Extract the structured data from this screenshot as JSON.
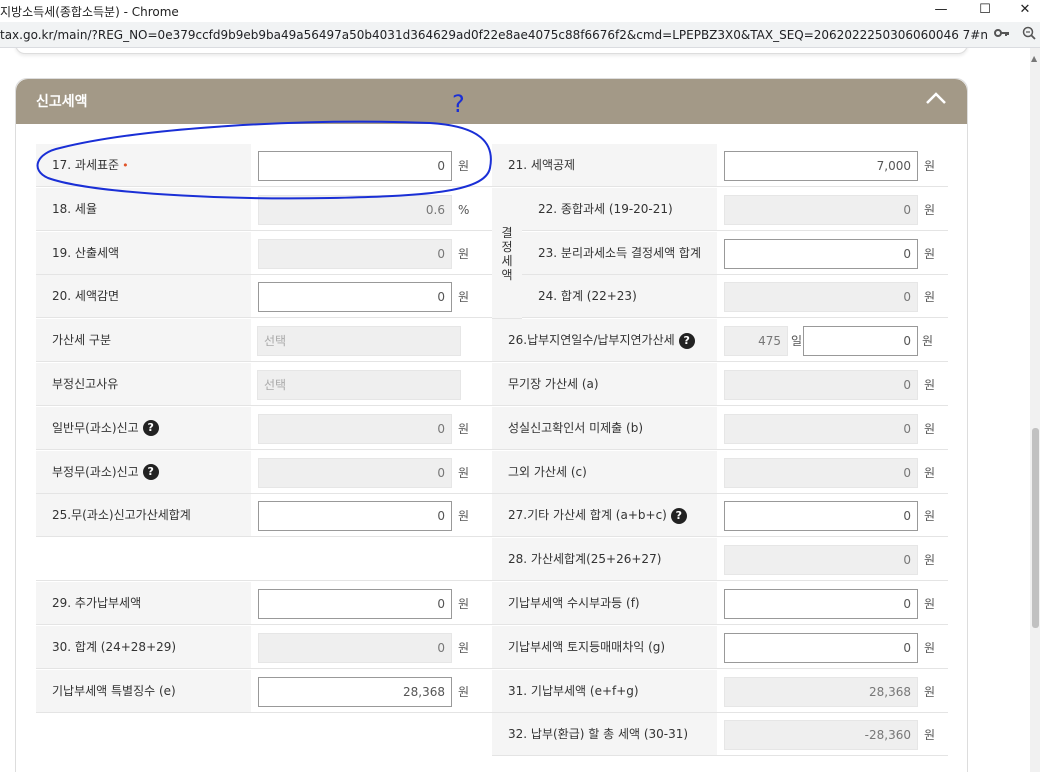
{
  "window": {
    "title": "지방소득세(종합소득분) - Chrome",
    "minimize": "—",
    "maximize": "☐",
    "close": "✕"
  },
  "address": {
    "url": "tax.go.kr/main/?REG_NO=0e379ccfd9b9eb9ba49a56497a50b4031d364629ad0f22e8ae4075c88f6676f2&cmd=LPEPBZ3X0&TAX_SEQ=2062022250306060046 7#n"
  },
  "section": {
    "title": "신고세액"
  },
  "annotation": {
    "mark": "?"
  },
  "units": {
    "won": "원",
    "percent": "%",
    "day": "일"
  },
  "left": [
    {
      "label": "17. 과세표준",
      "required": "•",
      "value": "0",
      "unit": "won",
      "editable": true
    },
    {
      "label": "18. 세율",
      "value": "0.6",
      "unit": "percent",
      "editable": false
    },
    {
      "label": "19. 산출세액",
      "value": "0",
      "unit": "won",
      "editable": false
    },
    {
      "label": "20. 세액감면",
      "value": "0",
      "unit": "won",
      "editable": true
    },
    {
      "label": "가산세 구분",
      "placeholder": "선택",
      "type": "select"
    },
    {
      "label": "부정신고사유",
      "placeholder": "선택",
      "type": "select"
    },
    {
      "label": "일반무(과소)신고",
      "help": "?",
      "value": "0",
      "unit": "won",
      "editable": false
    },
    {
      "label": "부정무(과소)신고",
      "help": "?",
      "value": "0",
      "unit": "won",
      "editable": false
    },
    {
      "label": "25.무(과소)신고가산세합계",
      "value": "0",
      "unit": "won",
      "editable": true
    },
    {
      "label": "29. 추가납부세액",
      "value": "0",
      "unit": "won",
      "editable": true
    },
    {
      "label": "30. 합계 (24+28+29)",
      "value": "0",
      "unit": "won",
      "editable": false
    },
    {
      "label": "기납부세액 특별징수 (e)",
      "value": "28,368",
      "unit": "won",
      "editable": true
    }
  ],
  "group_label": [
    "결",
    "정",
    "세",
    "액"
  ],
  "right": [
    {
      "label": "21. 세액공제",
      "value": "7,000",
      "unit": "won",
      "editable": true
    },
    {
      "label": "22. 종합과세 (19-20-21)",
      "value": "0",
      "unit": "won",
      "editable": false
    },
    {
      "label": "23. 분리과세소득 결정세액 합계",
      "value": "0",
      "unit": "won",
      "editable": true
    },
    {
      "label": "24. 합계 (22+23)",
      "value": "0",
      "unit": "won",
      "editable": false
    },
    {
      "label": "26.납부지연일수/납부지연가산세",
      "help": "?",
      "days": "475",
      "value": "0"
    },
    {
      "label": "무기장 가산세 (a)",
      "value": "0",
      "unit": "won",
      "editable": false
    },
    {
      "label": "성실신고확인서 미제출 (b)",
      "value": "0",
      "unit": "won",
      "editable": false
    },
    {
      "label": "그외 가산세 (c)",
      "value": "0",
      "unit": "won",
      "editable": false
    },
    {
      "label": "27.기타 가산세 합계 (a+b+c)",
      "help": "?",
      "value": "0",
      "unit": "won",
      "editable": true
    },
    {
      "label": "28. 가산세합계(25+26+27)",
      "value": "0",
      "unit": "won",
      "editable": false
    },
    {
      "label": "기납부세액 수시부과등 (f)",
      "value": "0",
      "unit": "won",
      "editable": true
    },
    {
      "label": "기납부세액 토지등매매차익 (g)",
      "value": "0",
      "unit": "won",
      "editable": true
    },
    {
      "label": "31. 기납부세액 (e+f+g)",
      "value": "28,368",
      "unit": "won",
      "editable": false
    },
    {
      "label": "32. 납부(환급) 할 총 세액 (30-31)",
      "value": "-28,360",
      "unit": "won",
      "editable": false
    }
  ]
}
